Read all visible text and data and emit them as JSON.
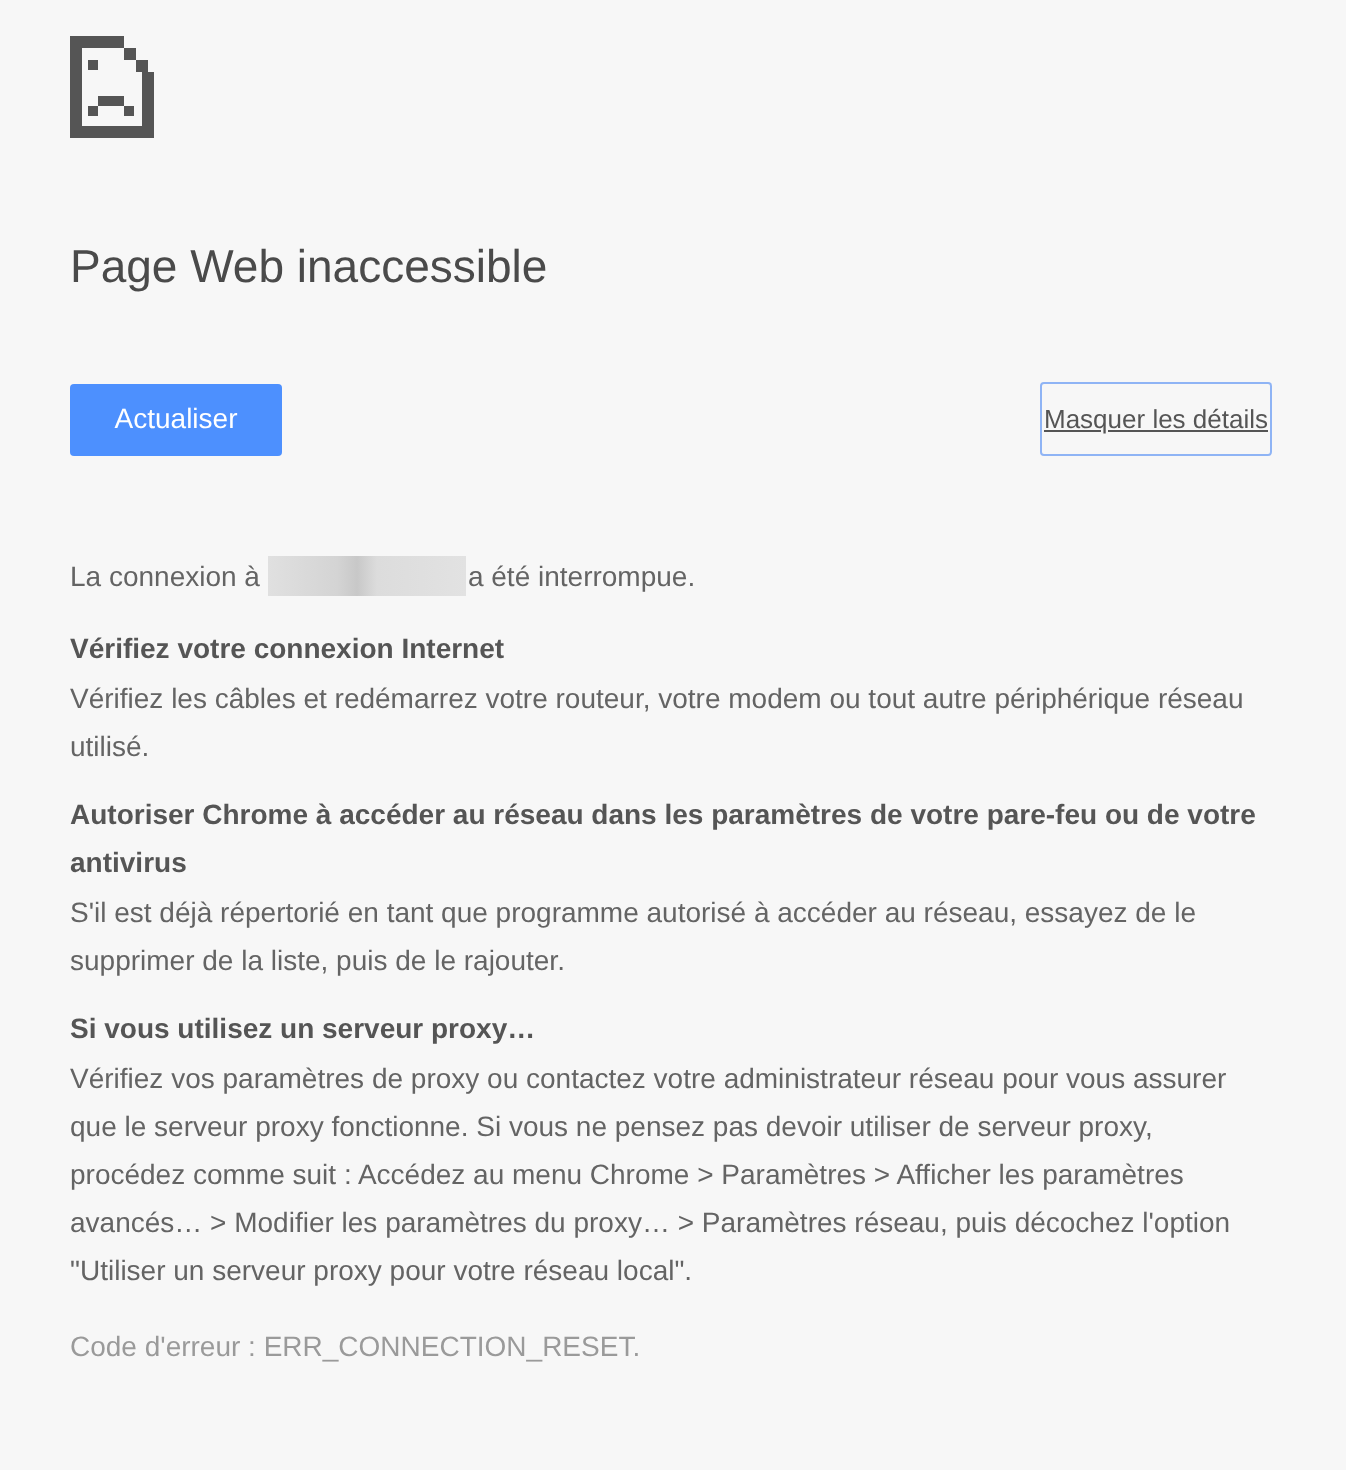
{
  "title": "Page Web inaccessible",
  "reload_button": "Actualiser",
  "details_button": "Masquer les détails",
  "connection": {
    "prefix": "La connexion à",
    "suffix": "a été interrompue."
  },
  "suggestions": [
    {
      "heading": "Vérifiez votre connexion Internet",
      "body": "Vérifiez les câbles et redémarrez votre routeur, votre modem ou tout autre périphérique réseau utilisé."
    },
    {
      "heading": "Autoriser Chrome à accéder au réseau dans les paramètres de votre pare-feu ou de votre antivirus",
      "body": "S'il est déjà répertorié en tant que programme autorisé à accéder au réseau, essayez de le supprimer de la liste, puis de le rajouter."
    },
    {
      "heading": "Si vous utilisez un serveur proxy…",
      "body": "Vérifiez vos paramètres de proxy ou contactez votre administrateur réseau pour vous assurer que le serveur proxy fonctionne. Si vous ne pensez pas devoir utiliser de serveur proxy, procédez comme suit : Accédez au menu Chrome > Paramètres > Afficher les paramètres avancés… > Modifier les paramètres du proxy… > Paramètres réseau, puis décochez l'option \"Utiliser un serveur proxy pour votre réseau local\"."
    }
  ],
  "error_code": "Code d'erreur : ERR_CONNECTION_RESET."
}
